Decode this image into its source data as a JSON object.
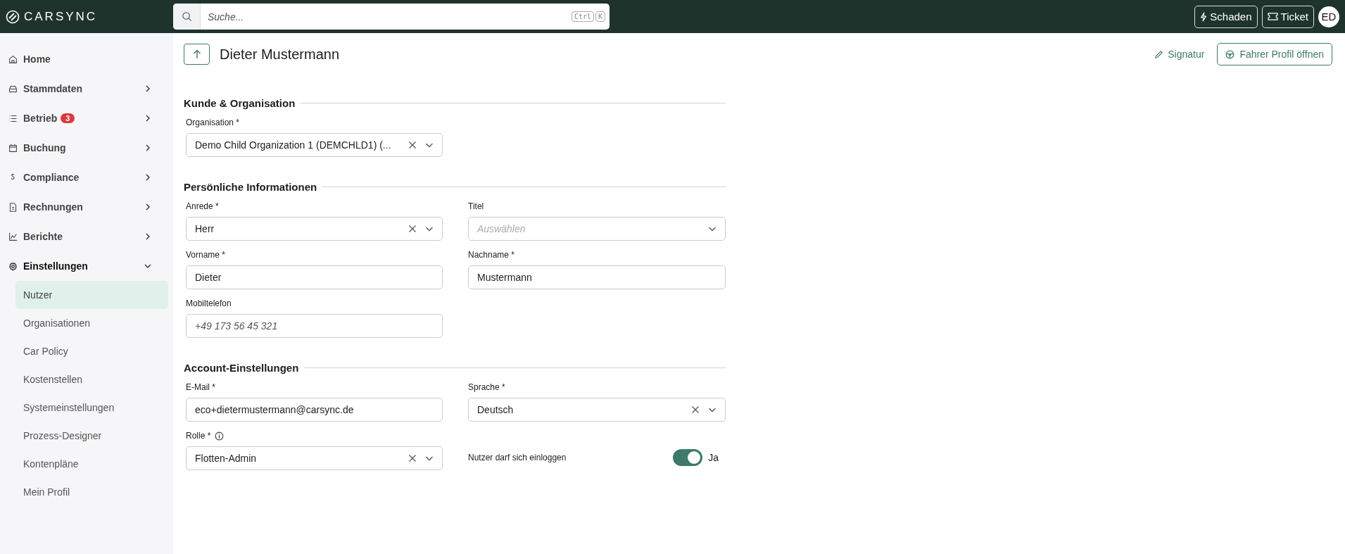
{
  "topbar": {
    "logo": "CARSYNC",
    "search": {
      "placeholder": "Suche...",
      "shortcut": [
        "Ctrl",
        "K"
      ]
    },
    "buttons": [
      {
        "kind": "bolt",
        "label": "Schaden"
      },
      {
        "kind": "ticket",
        "label": "Ticket"
      }
    ],
    "avatar": "ED"
  },
  "sidebar": {
    "items": [
      {
        "label": "Home",
        "chevron": false,
        "expanded": false
      },
      {
        "label": "Stammdaten",
        "chevron": true,
        "expanded": false
      },
      {
        "label": "Betrieb",
        "badge": "3",
        "chevron": true,
        "expanded": false
      },
      {
        "label": "Buchung",
        "chevron": true,
        "expanded": false
      },
      {
        "label": "Compliance",
        "chevron": true,
        "expanded": false
      },
      {
        "label": "Rechnungen",
        "chevron": true,
        "expanded": false
      },
      {
        "label": "Berichte",
        "chevron": true,
        "expanded": false
      },
      {
        "label": "Einstellungen",
        "chevron": true,
        "expanded": true,
        "children": [
          {
            "label": "Nutzer",
            "selected": true
          },
          {
            "label": "Organisationen",
            "selected": false
          },
          {
            "label": "Car Policy",
            "selected": false
          },
          {
            "label": "Kostenstellen",
            "selected": false
          },
          {
            "label": "Systemeinstellungen",
            "selected": false
          },
          {
            "label": "Prozess-Designer",
            "selected": false
          },
          {
            "label": "Kontenpläne",
            "selected": false
          },
          {
            "label": "Mein Profil",
            "selected": false
          }
        ]
      }
    ]
  },
  "header": {
    "title": "Dieter Mustermann",
    "actions": [
      {
        "kind": "link",
        "label": "Signatur"
      },
      {
        "kind": "button",
        "label": "Fahrer Profil öffnen"
      }
    ]
  },
  "sections": [
    {
      "title": "Kunde & Organisation",
      "fields": [
        {
          "kind": "select",
          "label": "Organisation *",
          "value": "Demo Child Organization 1 (DEMCHLD1) (...",
          "clearable": true,
          "info": false
        }
      ]
    },
    {
      "title": "Persönliche Informationen",
      "fields": [
        {
          "kind": "select",
          "label": "Anrede *",
          "value": "Herr",
          "clearable": true,
          "info": false
        },
        {
          "kind": "select",
          "label": "Titel",
          "placeholder": "Auswählen",
          "clearable": false,
          "info": false
        },
        {
          "kind": "text",
          "label": "Vorname *",
          "value": "Dieter",
          "info": false
        },
        {
          "kind": "text",
          "label": "Nachname *",
          "value": "Mustermann",
          "info": false
        },
        {
          "kind": "text",
          "label": "Mobiltelefon",
          "placeholder": "+49 173 56 45 321",
          "info": false
        }
      ]
    },
    {
      "title": "Account-Einstellungen",
      "fields": [
        {
          "kind": "text",
          "label": "E-Mail *",
          "value": "eco+dietermustermann@carsync.de",
          "info": false
        },
        {
          "kind": "select",
          "label": "Sprache *",
          "value": "Deutsch",
          "clearable": true,
          "info": false
        },
        {
          "kind": "select",
          "label": "Rolle *",
          "info": true,
          "value": "Flotten-Admin",
          "clearable": true
        },
        {
          "kind": "toggle",
          "label": "Nutzer darf sich einloggen",
          "on": true,
          "state_label": "Ja"
        }
      ]
    }
  ]
}
